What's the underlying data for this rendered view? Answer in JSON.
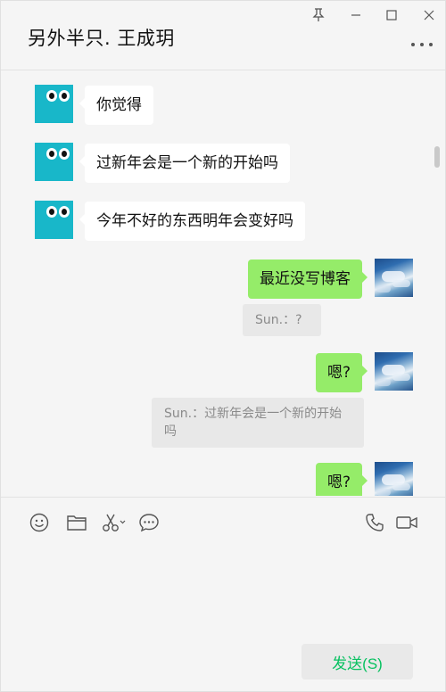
{
  "window": {
    "title": "另外半只. 王成玥"
  },
  "messages": [
    {
      "side": "left",
      "text": "你觉得"
    },
    {
      "side": "left",
      "text": "过新年会是一个新的开始吗"
    },
    {
      "side": "left",
      "text": "今年不好的东西明年会变好吗"
    },
    {
      "side": "right",
      "text": "最近没写博客"
    },
    {
      "side": "right",
      "quote": "Sun.：?"
    },
    {
      "side": "right",
      "text": "嗯?"
    },
    {
      "side": "right",
      "quote": "Sun.：过新年会是一个新的开始吗"
    },
    {
      "side": "right",
      "text": "嗯?"
    }
  ],
  "toolbar": {
    "icons": [
      "emoji-icon",
      "folder-icon",
      "scissors-icon",
      "chat-history-icon",
      "voice-call-icon",
      "video-call-icon"
    ]
  },
  "input": {
    "value": ""
  },
  "send": {
    "label": "发送(S)"
  },
  "colors": {
    "my_bubble": "#95ec69",
    "their_bubble": "#ffffff",
    "send_text": "#07c160",
    "avatar_cyan": "#18b7c9"
  }
}
